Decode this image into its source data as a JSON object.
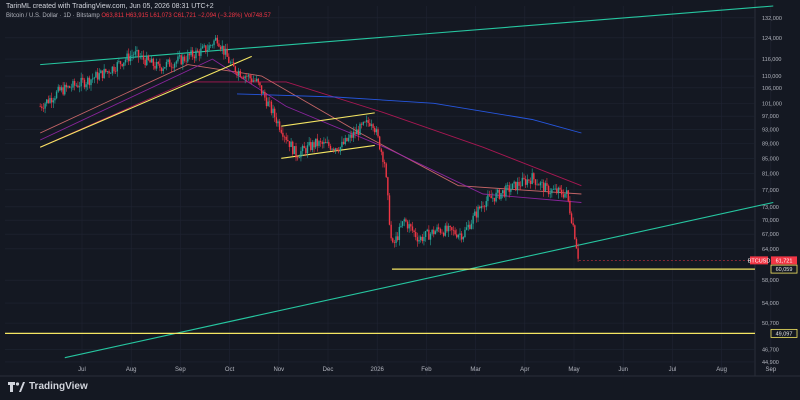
{
  "caption": "TarinML created with TradingView.com, Jun 05, 2026 08:31 UTC+2",
  "legend": {
    "symbol": "Bitcoin / U.S. Dollar · 1D · Bitstamp",
    "open": "O63,811",
    "high": "H63,915",
    "low": "L61,073",
    "close": "C61,721",
    "change": "−2,094 (−3.28%)",
    "volume": "Vol748.57"
  },
  "brand": "TradingView",
  "colors": {
    "background": "#141822",
    "grid": "#1f2433",
    "up": "#26a69a",
    "down": "#f23645",
    "trendline": "#26c6a0",
    "support": "#f5e663",
    "price_badge": "#f23645"
  },
  "chart_data": {
    "type": "candlestick",
    "symbol": "BTCUSD",
    "timeframe": "1D",
    "x_ticks": [
      "Jul",
      "Aug",
      "Sep",
      "Oct",
      "Nov",
      "Dec",
      "2026",
      "Feb",
      "Mar",
      "Apr",
      "May",
      "Jun",
      "Jul",
      "Aug",
      "Sep"
    ],
    "y_ticks": [
      132000,
      124000,
      116000,
      110000,
      106000,
      101000,
      97000,
      93000,
      89000,
      85000,
      81000,
      77000,
      73000,
      70000,
      67000,
      64000,
      58000,
      54000,
      50700,
      46700,
      44900
    ],
    "y_tick_labels": [
      "132,000",
      "124,000",
      "116,000",
      "110,000",
      "106,000",
      "101,000",
      "97,000",
      "93,000",
      "89,000",
      "85,000",
      "81,000",
      "77,000",
      "73,000",
      "70,000",
      "67,000",
      "64,000",
      "58,000",
      "54,000",
      "50,700",
      "46,700",
      "44,900"
    ],
    "y_scale": "log",
    "ylim": [
      43500,
      137000
    ],
    "current_price": {
      "symbol": "BTCUSD",
      "value": 61721,
      "label": "61,721"
    },
    "horizontal_levels": [
      {
        "value": 60059,
        "label": "60,059"
      },
      {
        "value": 49097,
        "label": "49,097"
      }
    ],
    "price_path": [
      {
        "m": 0.0,
        "p": 100000
      },
      {
        "m": 0.4,
        "p": 105000
      },
      {
        "m": 0.9,
        "p": 108000
      },
      {
        "m": 1.4,
        "p": 112000
      },
      {
        "m": 1.9,
        "p": 118000
      },
      {
        "m": 2.4,
        "p": 113000
      },
      {
        "m": 2.9,
        "p": 116000
      },
      {
        "m": 3.4,
        "p": 120000
      },
      {
        "m": 3.6,
        "p": 124000
      },
      {
        "m": 3.9,
        "p": 113000
      },
      {
        "m": 4.4,
        "p": 108000
      },
      {
        "m": 4.8,
        "p": 96000
      },
      {
        "m": 5.2,
        "p": 86000
      },
      {
        "m": 5.6,
        "p": 89000
      },
      {
        "m": 6.1,
        "p": 88000
      },
      {
        "m": 6.4,
        "p": 92000
      },
      {
        "m": 6.75,
        "p": 96000
      },
      {
        "m": 7.0,
        "p": 84000
      },
      {
        "m": 7.15,
        "p": 64000
      },
      {
        "m": 7.4,
        "p": 70000
      },
      {
        "m": 7.7,
        "p": 66000
      },
      {
        "m": 8.1,
        "p": 68000
      },
      {
        "m": 8.6,
        "p": 67000
      },
      {
        "m": 9.0,
        "p": 74000
      },
      {
        "m": 9.5,
        "p": 77000
      },
      {
        "m": 10.0,
        "p": 80000
      },
      {
        "m": 10.3,
        "p": 77000
      },
      {
        "m": 10.7,
        "p": 76000
      },
      {
        "m": 10.85,
        "p": 68000
      },
      {
        "m": 10.95,
        "p": 61721
      }
    ],
    "moving_averages": [
      {
        "color": "#c2185b",
        "points": [
          {
            "m": 0,
            "p": 88000
          },
          {
            "m": 3,
            "p": 108000
          },
          {
            "m": 5,
            "p": 108000
          },
          {
            "m": 7,
            "p": 98000
          },
          {
            "m": 9,
            "p": 88000
          },
          {
            "m": 11,
            "p": 78000
          }
        ]
      },
      {
        "color": "#e57373",
        "points": [
          {
            "m": 0,
            "p": 92000
          },
          {
            "m": 3,
            "p": 114000
          },
          {
            "m": 4.5,
            "p": 110000
          },
          {
            "m": 6.5,
            "p": 92000
          },
          {
            "m": 8.5,
            "p": 78000
          },
          {
            "m": 11,
            "p": 76000
          }
        ]
      },
      {
        "color": "#2962ff",
        "points": [
          {
            "m": 4,
            "p": 104000
          },
          {
            "m": 6,
            "p": 103000
          },
          {
            "m": 8,
            "p": 101000
          },
          {
            "m": 10,
            "p": 96000
          },
          {
            "m": 11,
            "p": 92000
          }
        ]
      },
      {
        "color": "#9c27b0",
        "points": [
          {
            "m": 0,
            "p": 90000
          },
          {
            "m": 3.5,
            "p": 116000
          },
          {
            "m": 5,
            "p": 100000
          },
          {
            "m": 7,
            "p": 88000
          },
          {
            "m": 9,
            "p": 76000
          },
          {
            "m": 11,
            "p": 74000
          }
        ]
      }
    ],
    "trendlines": [
      {
        "color": "#26c6a0",
        "from": {
          "m": 0,
          "p": 114000
        },
        "to": {
          "m": 14.9,
          "p": 137000
        }
      },
      {
        "color": "#26c6a0",
        "from": {
          "m": 0.5,
          "p": 45500
        },
        "to": {
          "m": 14.9,
          "p": 74000
        }
      },
      {
        "color": "#f5e663",
        "from": {
          "m": 0,
          "p": 88000
        },
        "to": {
          "m": 4.3,
          "p": 117000
        }
      },
      {
        "color": "#f5e663",
        "from": {
          "m": 4.9,
          "p": 94000
        },
        "to": {
          "m": 6.8,
          "p": 98000
        }
      },
      {
        "color": "#f5e663",
        "from": {
          "m": 4.9,
          "p": 85000
        },
        "to": {
          "m": 6.8,
          "p": 88500
        }
      }
    ]
  }
}
